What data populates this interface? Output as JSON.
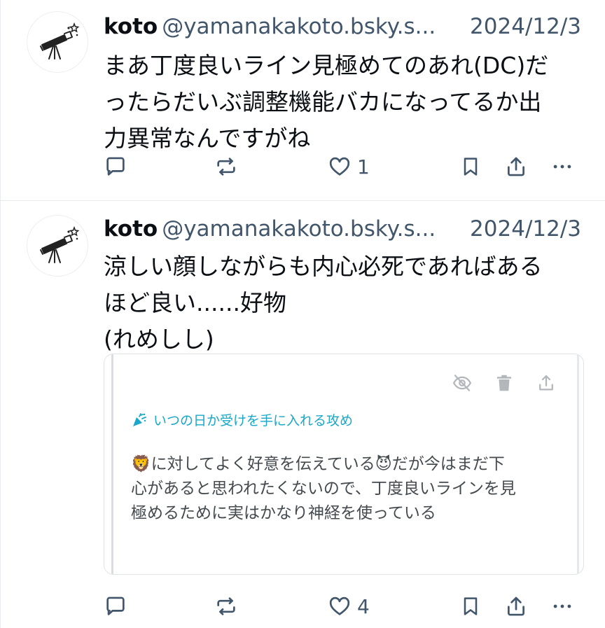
{
  "posts": [
    {
      "author": "koto",
      "handle": "@yamanakakoto.bsky.s...",
      "date": "2024/12/3",
      "text": "まあ丁度良いライン見極めてのあれ(DC)だ\nったらだいぶ調整機能バカになってるか出\n力異常なんですがね",
      "likes": "1"
    },
    {
      "author": "koto",
      "handle": "@yamanakakoto.bsky.s...",
      "date": "2024/12/3",
      "text": "涼しい顔しながらも内心必死であればある\nほど良い......好物\n(れめしし)",
      "likes": "4",
      "embed": {
        "subtitle": "いつの日か受けを手に入れる攻め",
        "text": "🦁に対してよく好意を伝えている😈だが今はまだ下\n心があると思われたくないので、丁度良いラインを見\n極めるために実はかなり神経を使っている",
        "subtitle_icon": "party-popper-icon",
        "tool_icons": [
          "eye-off-icon",
          "trash-icon",
          "share-icon"
        ]
      }
    }
  ],
  "icons": [
    "reply-icon",
    "repost-icon",
    "heart-icon",
    "bookmark-icon",
    "share-icon",
    "more-icon"
  ],
  "colors": {
    "muted": "#42566b",
    "accent": "#1aa7c9",
    "text": "#0b0f14"
  }
}
